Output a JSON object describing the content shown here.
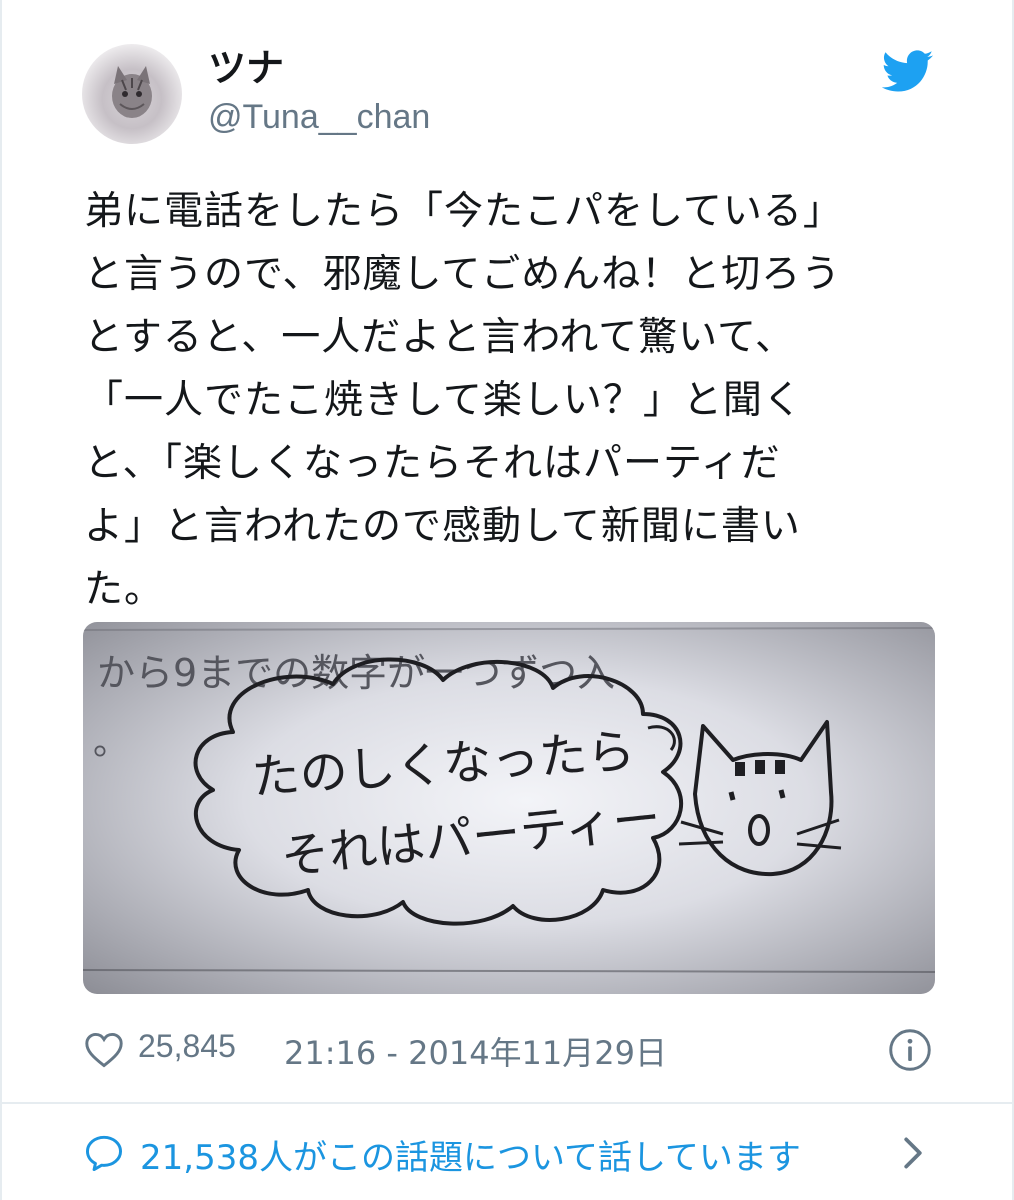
{
  "user": {
    "display_name": "ツナ",
    "handle": "@Tuna__chan",
    "avatar_icon": "cat-photo-avatar"
  },
  "brand": {
    "icon": "twitter-bird-icon",
    "color": "#1da1f2"
  },
  "tweet": {
    "lines": [
      "弟に電話をしたら「今たこパをしている」",
      "と言うので、邪魔してごめんね！と切ろう",
      "とすると、一人だよと言われて驚いて、",
      "「一人でたこ焼きして楽しい？」と聞く",
      "と、「楽しくなったらそれはパーティだ",
      "よ」と言われたので感動して新聞に書い",
      "た。"
    ]
  },
  "photo": {
    "printed_text": "から9までの数字が一つずつ入",
    "printed_text_2": "。",
    "handwriting_line1": "たのしくなったら",
    "handwriting_line2": "それはパーティー"
  },
  "meta": {
    "like_count": "25,845",
    "timestamp": "21:16 - 2014年11月29日"
  },
  "conversation": {
    "text": "21,538人がこの話題について話しています",
    "link_color": "#1b95e0"
  }
}
